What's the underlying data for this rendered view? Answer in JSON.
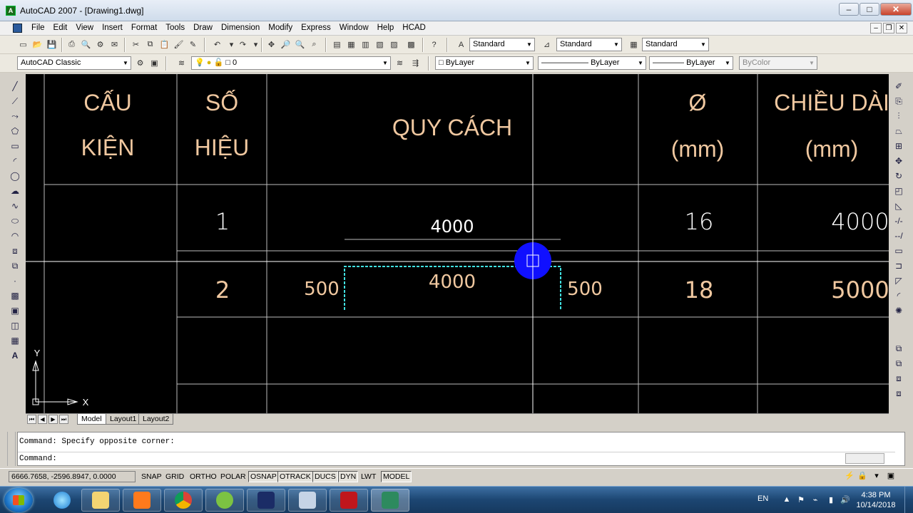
{
  "window": {
    "title": "AutoCAD 2007 - [Drawing1.dwg]",
    "buttons": {
      "minimize": "–",
      "maximize": "□",
      "close": "✕"
    }
  },
  "menu": {
    "items": [
      "File",
      "Edit",
      "View",
      "Insert",
      "Format",
      "Tools",
      "Draw",
      "Dimension",
      "Modify",
      "Express",
      "Window",
      "Help",
      "HCAD"
    ],
    "mdi": {
      "minimize": "–",
      "restore": "❐",
      "close": "✕"
    }
  },
  "toolbar_styles": {
    "text_style": "Standard",
    "dim_style": "Standard",
    "table_style": "Standard"
  },
  "toolbar_properties": {
    "workspace": "AutoCAD Classic",
    "layer": "0",
    "color": "ByLayer",
    "linetype": "ByLayer",
    "lineweight": "ByLayer",
    "plotstyle": "ByColor"
  },
  "drawing": {
    "headers": {
      "cau_kien_1": "CẤU",
      "cau_kien_2": "KIỆN",
      "so_hieu_1": "SỐ",
      "so_hieu_2": "HIỆU",
      "quy_cach": "QUY CÁCH",
      "phi_1": "Ø",
      "phi_2": "(mm)",
      "chieu_dai_1": "CHIỀU DÀI",
      "chieu_dai_2": "(mm)"
    },
    "row1": {
      "so_hieu": "1",
      "dim": "4000",
      "phi": "16",
      "chieu_dai": "4000"
    },
    "row2": {
      "so_hieu": "2",
      "left": "500",
      "dim": "4000",
      "right": "500",
      "phi": "18",
      "chieu_dai": "5000"
    },
    "ucs": {
      "x": "X",
      "y": "Y"
    },
    "colors": {
      "text": "#f0c8a0",
      "dim_text": "#ffffff",
      "grid": "#bdbdbd",
      "selected": "#40e0e0",
      "cursor_blob": "#1010ff"
    }
  },
  "tabs": {
    "model": "Model",
    "layout1": "Layout1",
    "layout2": "Layout2"
  },
  "command": {
    "history": "Command: Specify opposite corner:",
    "prompt": "Command:"
  },
  "status": {
    "coords": "6666.7658, -2596.8947, 0.0000",
    "toggles": [
      {
        "label": "SNAP",
        "on": false
      },
      {
        "label": "GRID",
        "on": false
      },
      {
        "label": "ORTHO",
        "on": false
      },
      {
        "label": "POLAR",
        "on": false
      },
      {
        "label": "OSNAP",
        "on": true
      },
      {
        "label": "OTRACK",
        "on": true
      },
      {
        "label": "DUCS",
        "on": true
      },
      {
        "label": "DYN",
        "on": true
      },
      {
        "label": "LWT",
        "on": false
      },
      {
        "label": "MODEL",
        "on": true
      }
    ]
  },
  "taskbar": {
    "lang": "EN",
    "time": "4:38 PM",
    "date": "10/14/2018"
  }
}
